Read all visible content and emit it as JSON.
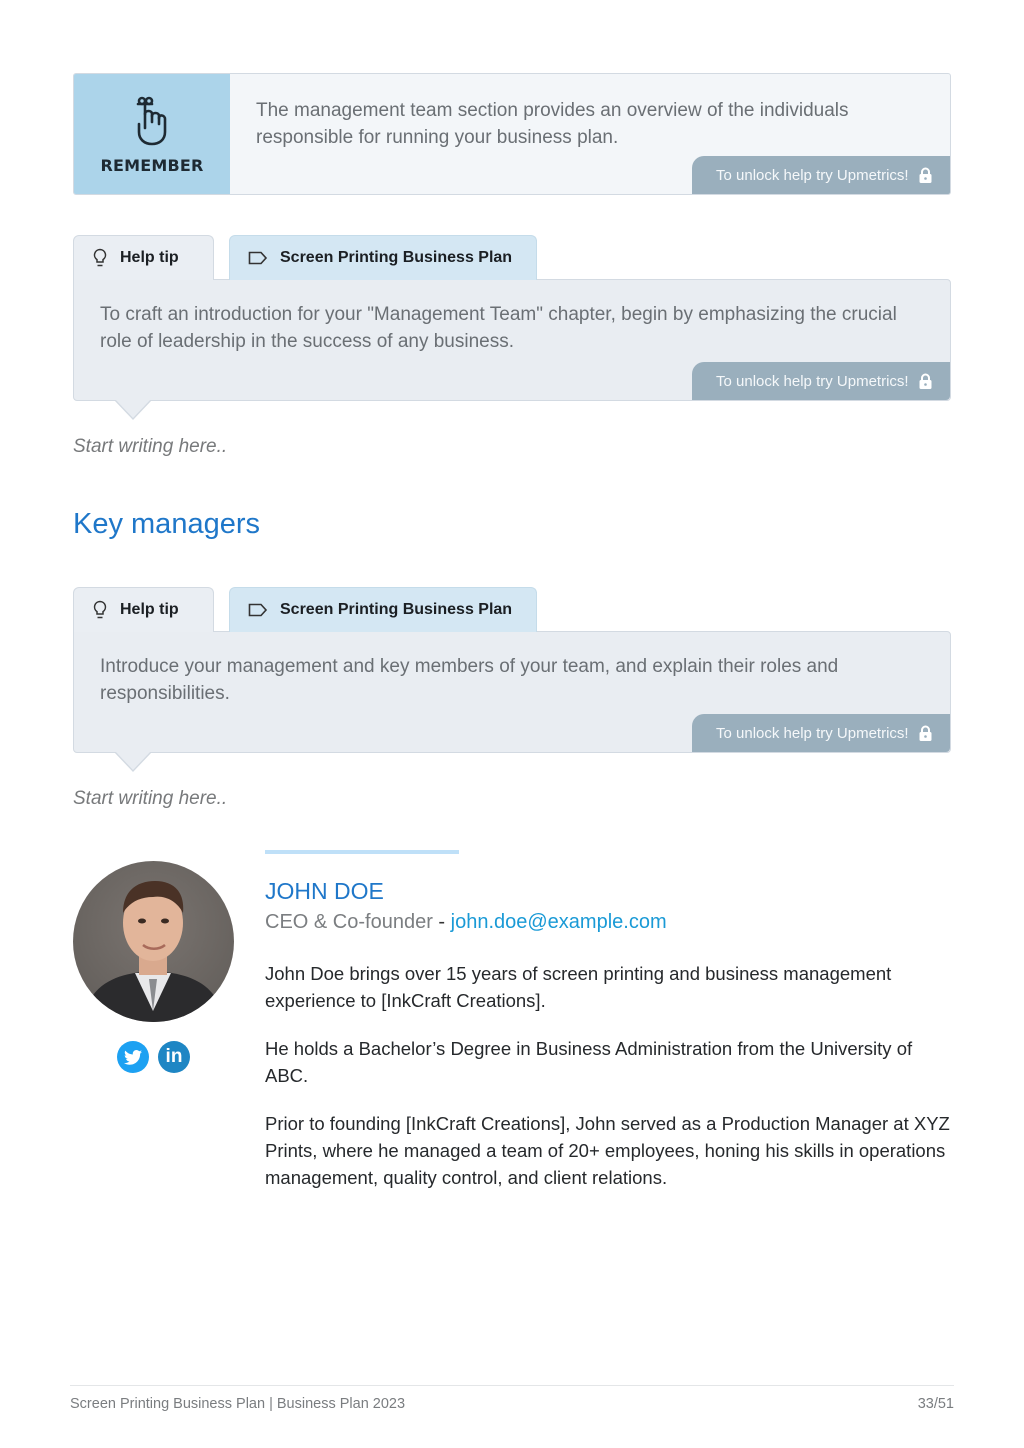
{
  "remember": {
    "label": "REMEMBER",
    "icon": "finger-string-icon",
    "text": "The management team section provides an overview of the individuals responsible for running your business plan.",
    "unlock": "To unlock help try Upmetrics!"
  },
  "help_blocks": [
    {
      "tab_help": "Help tip",
      "tab_plan": "Screen Printing Business Plan",
      "text": "To craft an introduction for your \"Management Team\" chapter, begin by emphasizing the crucial role of leadership in the success of any business.",
      "unlock": "To unlock help try Upmetrics!",
      "placeholder": "Start writing here.."
    },
    {
      "tab_help": "Help tip",
      "tab_plan": "Screen Printing Business Plan",
      "text": "Introduce your management and key members of your team, and explain their roles and responsibilities.",
      "unlock": "To unlock help try Upmetrics!",
      "placeholder": "Start writing here.."
    }
  ],
  "section_title": "Key managers",
  "person": {
    "name": "JOHN DOE",
    "role": "CEO & Co-founder",
    "separator": " - ",
    "email": "john.doe@example.com",
    "social": [
      {
        "icon": "twitter-icon",
        "glyph": "🐦"
      },
      {
        "icon": "linkedin-icon",
        "glyph": "in"
      }
    ],
    "bio": [
      "John Doe brings over 15 years of screen printing and business management experience to [InkCraft Creations].",
      "He holds a Bachelor’s Degree in Business Administration from the University of ABC.",
      "Prior to founding [InkCraft Creations], John served as a Production Manager at XYZ Prints, where he managed a team of 20+ employees, honing his skills in operations management, quality control, and client relations."
    ]
  },
  "footer": {
    "left": "Screen Printing Business Plan | Business Plan 2023",
    "page": "33/51"
  },
  "colors": {
    "accent": "#1f77c9",
    "link": "#1a9ad6",
    "remember_bg": "#acd4ea",
    "unlock_bg": "#9aafbd"
  }
}
